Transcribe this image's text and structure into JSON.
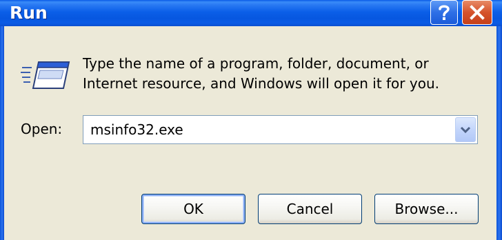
{
  "window": {
    "title": "Run"
  },
  "titlebar_buttons": {
    "help_icon": "question-mark-icon",
    "close_icon": "close-x-icon"
  },
  "dialog": {
    "icon": "run-icon",
    "description_line1": "Type the name of a program, folder, document, or",
    "description_line2": "Internet resource, and Windows will open it for you.",
    "open_label": "Open:",
    "open_value": "msinfo32.exe"
  },
  "buttons": {
    "ok": "OK",
    "cancel": "Cancel",
    "browse": "Browse..."
  },
  "colors": {
    "titlebar": "#0b5fe8",
    "dialog_background": "#ece9d8",
    "close_button": "#d5532c",
    "help_button": "#2e6fe6"
  }
}
